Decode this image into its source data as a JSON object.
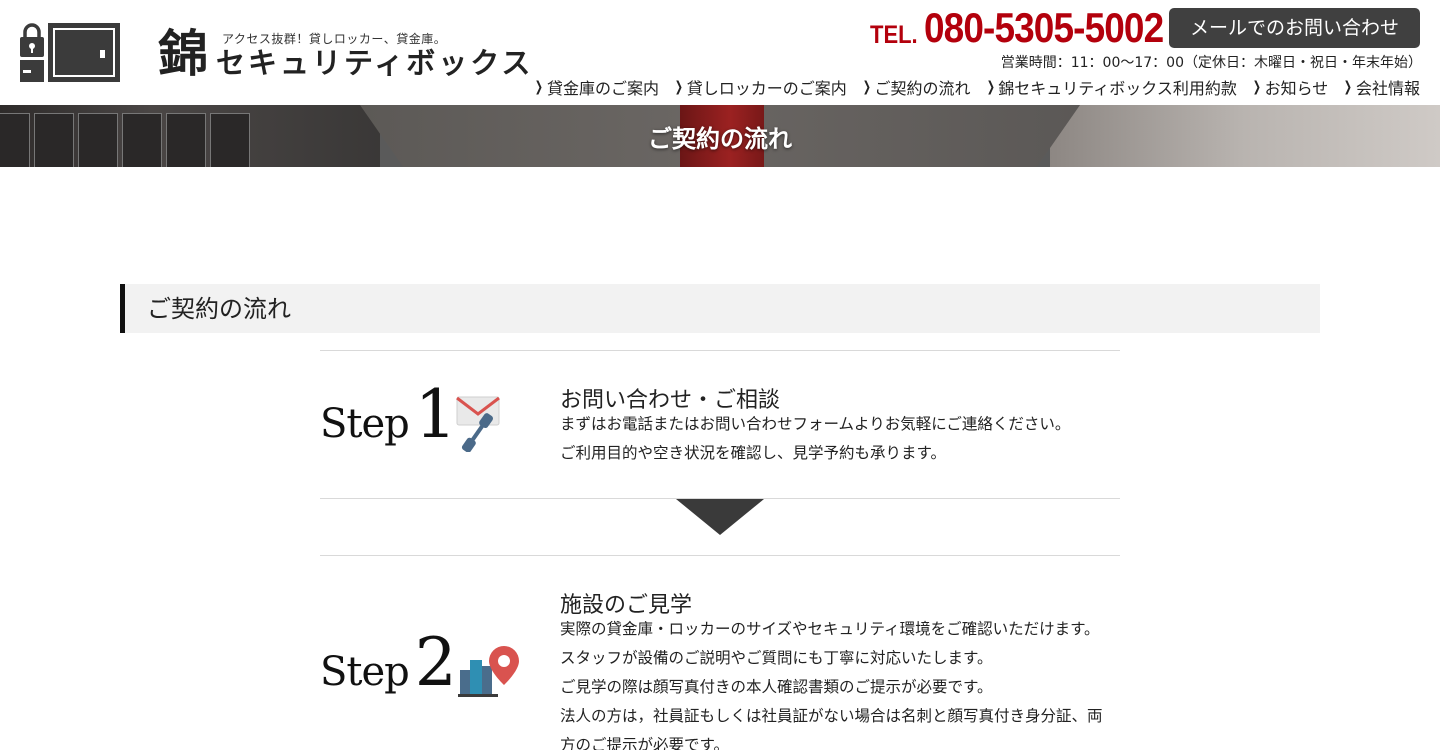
{
  "header": {
    "tagline": "アクセス抜群！貸しロッカー、貸金庫。",
    "logo_kanji": "錦",
    "logo_name": "セキュリティボックス",
    "tel_label": "TEL.",
    "tel_number": "080-5305-5002",
    "mail_button": "メールでのお問い合わせ",
    "hours": "営業時間：11：00〜17：00（定休日：木曜日・祝日・年末年始）",
    "nav": [
      {
        "label": "貸金庫のご案内"
      },
      {
        "label": "貸しロッカーのご案内"
      },
      {
        "label": "ご契約の流れ"
      },
      {
        "label": "錦セキュリティボックス利用約款"
      },
      {
        "label": "お知らせ"
      },
      {
        "label": "会社情報"
      }
    ]
  },
  "hero": {
    "title": "ご契約の流れ"
  },
  "section": {
    "heading": "ご契約の流れ"
  },
  "steps": [
    {
      "word": "Step",
      "number": "1",
      "icon": "mail-phone-icon",
      "title": "お問い合わせ・ご相談",
      "lines": [
        "まずはお電話またはお問い合わせフォームよりお気軽にご連絡ください。",
        "ご利用目的や空き状況を確認し、見学予約も承ります。"
      ]
    },
    {
      "word": "Step",
      "number": "2",
      "icon": "building-location-icon",
      "title": "施設のご見学",
      "lines": [
        "実際の貸金庫・ロッカーのサイズやセキュリティ環境をご確認いただけます。",
        "スタッフが設備のご説明やご質問にも丁寧に対応いたします。",
        "ご見学の際は顔写真付きの本人確認書類のご提示が必要です。",
        "法人の方は，社員証もしくは社員証がない場合は名刺と顔写真付き身分証、両",
        "方のご提示が必要です。"
      ]
    }
  ],
  "colors": {
    "accent_red": "#b3000c",
    "button_dark": "#404040",
    "heading_bg": "#f2f2f2"
  }
}
